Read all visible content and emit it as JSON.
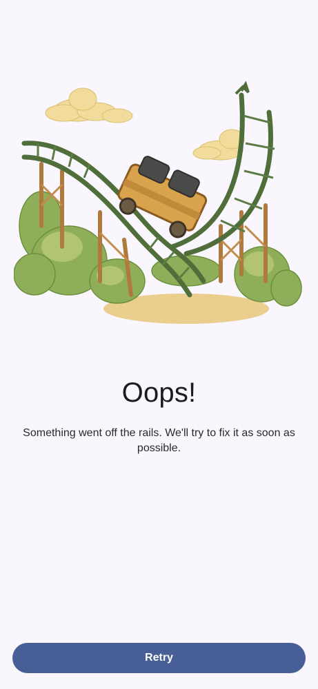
{
  "error_screen": {
    "illustration_icon": "broken-roller-coaster-illustration",
    "title": "Oops!",
    "message": "Something went off the rails. We'll try to fix it as soon as possible.",
    "retry_label": "Retry"
  },
  "colors": {
    "background": "#f9f7fd",
    "primary_button": "#475f96",
    "button_text": "#ffffff",
    "title_text": "#1d1b20"
  }
}
